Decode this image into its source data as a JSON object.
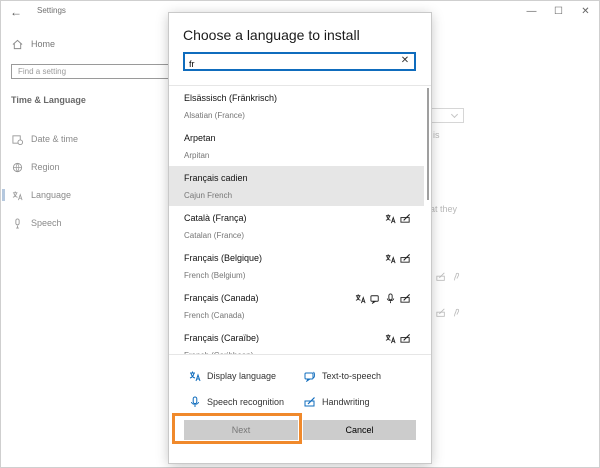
{
  "app": {
    "title": "Settings",
    "back_glyph": "←"
  },
  "window_controls": {
    "minimize": "—",
    "maximize": "☐",
    "close": "✕"
  },
  "settings_nav": {
    "home_label": "Home",
    "search_placeholder": "Find a setting",
    "section_title": "Time & Language",
    "items": [
      {
        "label": "Date & time",
        "icon": "calendar-clock-icon",
        "selected": false
      },
      {
        "label": "Region",
        "icon": "globe-icon",
        "selected": false
      },
      {
        "label": "Language",
        "icon": "language-icon",
        "selected": true
      },
      {
        "label": "Speech",
        "icon": "microphone-icon",
        "selected": false
      }
    ]
  },
  "background_fragments": {
    "text_1": "is",
    "text_2": "at they"
  },
  "dialog": {
    "title": "Choose a language to install",
    "search_value": "fr",
    "clear_glyph": "✕",
    "languages": [
      {
        "name": "Elsässisch (Fränkrisch)",
        "english": "Alsatian (France)",
        "features": []
      },
      {
        "name": "Arpetan",
        "english": "Arpitan",
        "features": []
      },
      {
        "name": "Français cadien",
        "english": "Cajun French",
        "features": [],
        "hovered": true
      },
      {
        "name": "Català (França)",
        "english": "Catalan (France)",
        "features": [
          "display-language",
          "handwriting"
        ]
      },
      {
        "name": "Français (Belgique)",
        "english": "French (Belgium)",
        "features": [
          "display-language",
          "handwriting"
        ]
      },
      {
        "name": "Français (Canada)",
        "english": "French (Canada)",
        "features": [
          "display-language",
          "text-to-speech",
          "speech-recognition",
          "handwriting"
        ]
      },
      {
        "name": "Français (Caraïbe)",
        "english": "French (Caribbean)",
        "features": [
          "display-language",
          "handwriting"
        ]
      }
    ],
    "legend": {
      "display_language": "Display language",
      "text_to_speech": "Text-to-speech",
      "speech_recognition": "Speech recognition",
      "handwriting": "Handwriting"
    },
    "next_label": "Next",
    "cancel_label": "Cancel"
  },
  "colors": {
    "accent": "#0f6cbd",
    "highlight": "#f0892b",
    "hover_row": "#e6e6e6",
    "button": "#cccccc"
  }
}
